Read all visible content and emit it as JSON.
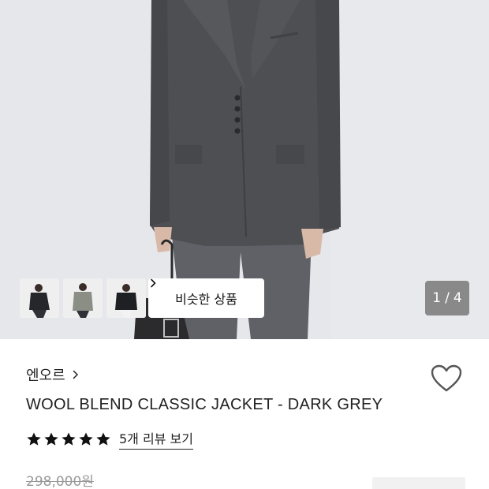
{
  "gallery": {
    "similar_label": "비슷한 상품",
    "counter_current": "1",
    "counter_sep": "/",
    "counter_total": "4"
  },
  "product": {
    "brand": "엔오르",
    "title": "WOOL BLEND CLASSIC JACKET - DARK GREY",
    "rating": 5,
    "review_link": "5개 리뷰 보기",
    "original_price": "298,000원"
  },
  "icons": {
    "brand_chevron": "chevron-right-icon",
    "similar_chevron": "chevron-right-icon",
    "wishlist": "heart-outline-icon",
    "star": "star-filled-icon"
  },
  "colors": {
    "text": "#222222",
    "muted": "#999999",
    "counter_bg": "#6e6e6e",
    "jacket": "#4b4d50"
  }
}
